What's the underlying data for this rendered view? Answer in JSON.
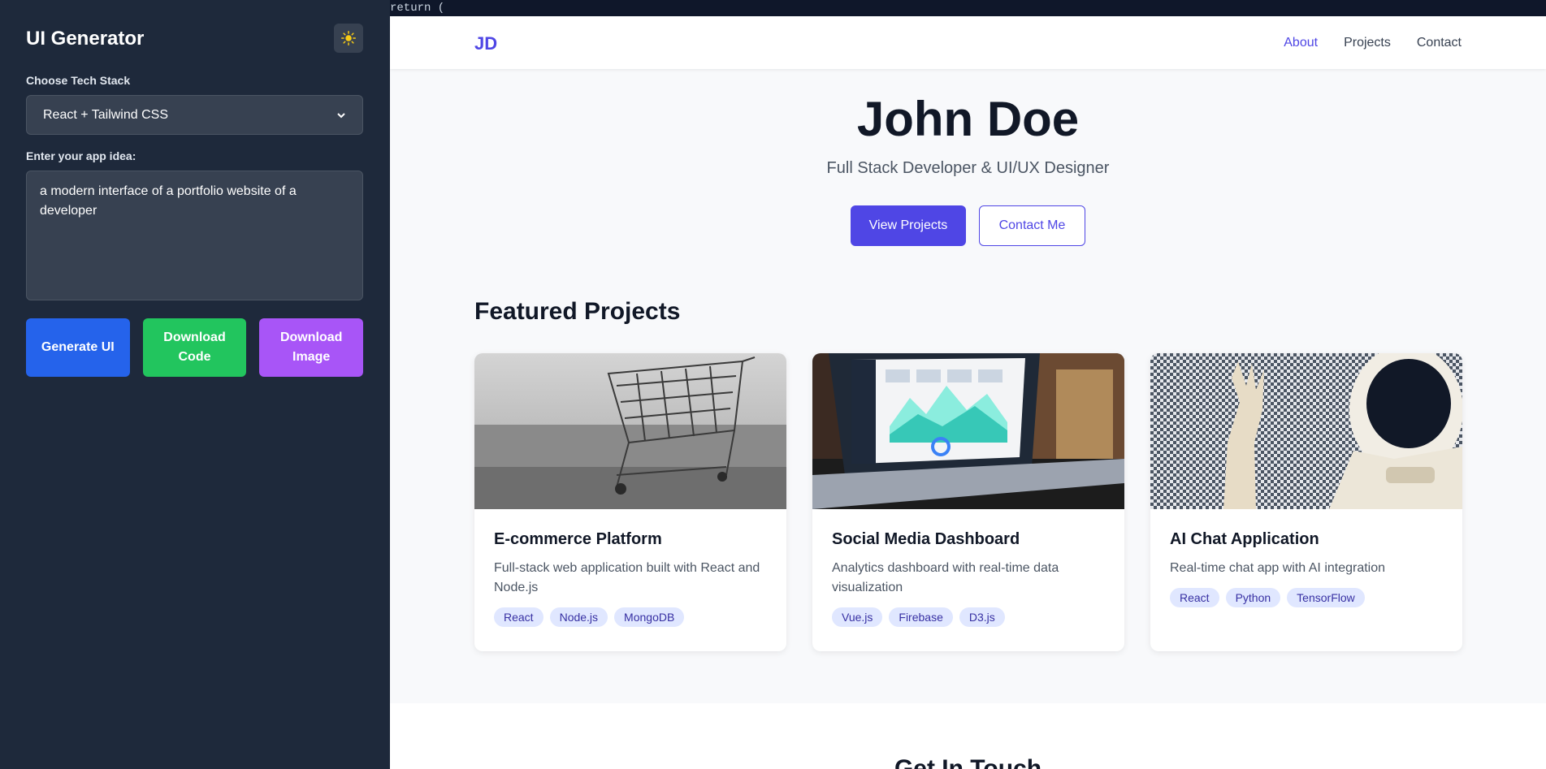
{
  "sidebar": {
    "title": "UI Generator",
    "tech_label": "Choose Tech Stack",
    "tech_value": "React + Tailwind CSS",
    "idea_label": "Enter your app idea:",
    "idea_value": "a modern interface of a portfolio website of a developer",
    "buttons": {
      "generate": "Generate UI",
      "download_code": "Download Code",
      "download_image": "Download Image"
    }
  },
  "preview": {
    "code_snippet": "return (",
    "brand": "JD",
    "nav": [
      "About",
      "Projects",
      "Contact"
    ],
    "hero": {
      "name": "John Doe",
      "subtitle": "Full Stack Developer & UI/UX Designer",
      "primary_btn": "View Projects",
      "secondary_btn": "Contact Me"
    },
    "projects_title": "Featured Projects",
    "projects": [
      {
        "title": "E-commerce Platform",
        "description": "Full-stack web application built with React and Node.js",
        "tags": [
          "React",
          "Node.js",
          "MongoDB"
        ],
        "image": "shopping-cart-photo"
      },
      {
        "title": "Social Media Dashboard",
        "description": "Analytics dashboard with real-time data visualization",
        "tags": [
          "Vue.js",
          "Firebase",
          "D3.js"
        ],
        "image": "laptop-dashboard-photo"
      },
      {
        "title": "AI Chat Application",
        "description": "Real-time chat app with AI integration",
        "tags": [
          "React",
          "Python",
          "TensorFlow"
        ],
        "image": "asimo-robot-photo"
      }
    ],
    "contact_title": "Get In Touch"
  },
  "colors": {
    "sidebar_bg": "#1e293b",
    "accent": "#4f46e5",
    "generate": "#2563eb",
    "download_code": "#22c55e",
    "download_image": "#a855f7"
  }
}
